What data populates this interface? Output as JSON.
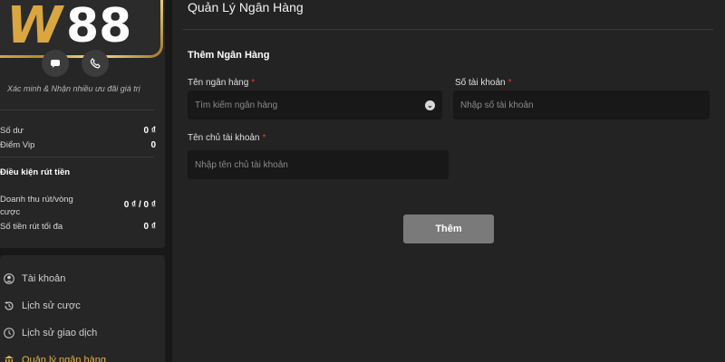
{
  "brand": {
    "logo_w": "W",
    "logo_num": "88"
  },
  "sidebar": {
    "verify_icons": [
      "chat-icon",
      "phone-icon"
    ],
    "verify_text": "Xác minh & Nhận nhiều ưu đãi giá trị",
    "balance_label": "Số dư",
    "balance_value": "0 ₫",
    "vip_label": "Điểm Vip",
    "vip_value": "0",
    "withdraw_title": "Điều kiện rút tiền",
    "wager_label": "Doanh thu rút/vòng cược",
    "wager_value": "0 ₫ / 0 ₫",
    "max_withdraw_label": "Số tiền rút tối đa",
    "max_withdraw_value": "0 ₫",
    "menu": [
      {
        "label": "Tài khoản",
        "icon": "user-icon"
      },
      {
        "label": "Lịch sử cược",
        "icon": "history-icon"
      },
      {
        "label": "Lịch sử giao dịch",
        "icon": "transaction-icon"
      },
      {
        "label": "Quản lý ngân hàng",
        "icon": "bank-icon",
        "active": true
      }
    ],
    "accent_color": "#e3b54b"
  },
  "main": {
    "page_title": "Quản Lý Ngân Hàng",
    "form_title": "Thêm Ngân Hàng",
    "bank_name_label": "Tên ngân hàng",
    "bank_name_placeholder": "Tìm kiếm ngân hàng",
    "account_number_label": "Số tài khoản",
    "account_number_placeholder": "Nhập số tài khoản",
    "account_holder_label": "Tên chủ tài khoản",
    "account_holder_placeholder": "Nhập tên chủ tài khoản",
    "required_mark": "*",
    "submit_label": "Thêm"
  }
}
